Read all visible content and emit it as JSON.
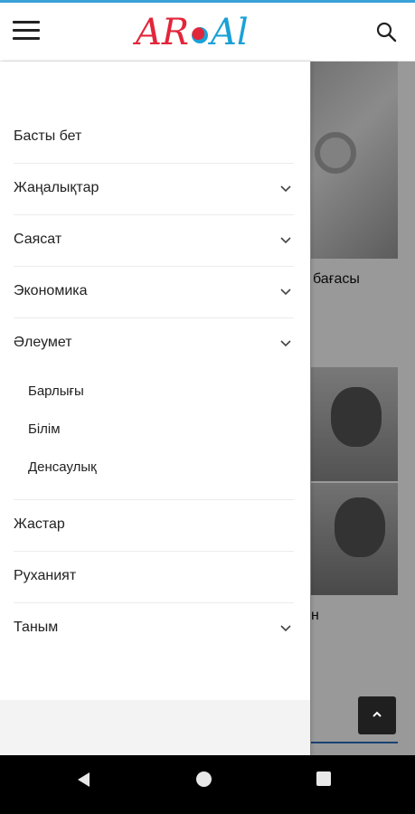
{
  "header": {
    "logo_left": "AR",
    "logo_right": "Al",
    "menu_icon": "hamburger-icon",
    "search_icon": "search-icon"
  },
  "background": {
    "article_text_1": "бағасы",
    "article_text_2": "н"
  },
  "drawer": {
    "items": [
      {
        "label": "Басты бет",
        "has_submenu": false
      },
      {
        "label": "Жаңалықтар",
        "has_submenu": true
      },
      {
        "label": "Саясат",
        "has_submenu": true
      },
      {
        "label": "Экономика",
        "has_submenu": true
      },
      {
        "label": "Әлеумет",
        "has_submenu": true,
        "expanded": true,
        "subitems": [
          {
            "label": "Барлығы"
          },
          {
            "label": "Білім"
          },
          {
            "label": "Денсаулық"
          }
        ]
      },
      {
        "label": "Жастар",
        "has_submenu": false
      },
      {
        "label": "Руханият",
        "has_submenu": false
      },
      {
        "label": "Таным",
        "has_submenu": true
      }
    ]
  },
  "scroll_top_icon": "chevron-up-icon",
  "navbar": {
    "back_icon": "back-triangle-icon",
    "home_icon": "home-circle-icon",
    "recent_icon": "recents-square-icon"
  },
  "colors": {
    "accent_red": "#e2263a",
    "accent_blue": "#1aa1d6",
    "top_line": "#3aa0d8"
  }
}
